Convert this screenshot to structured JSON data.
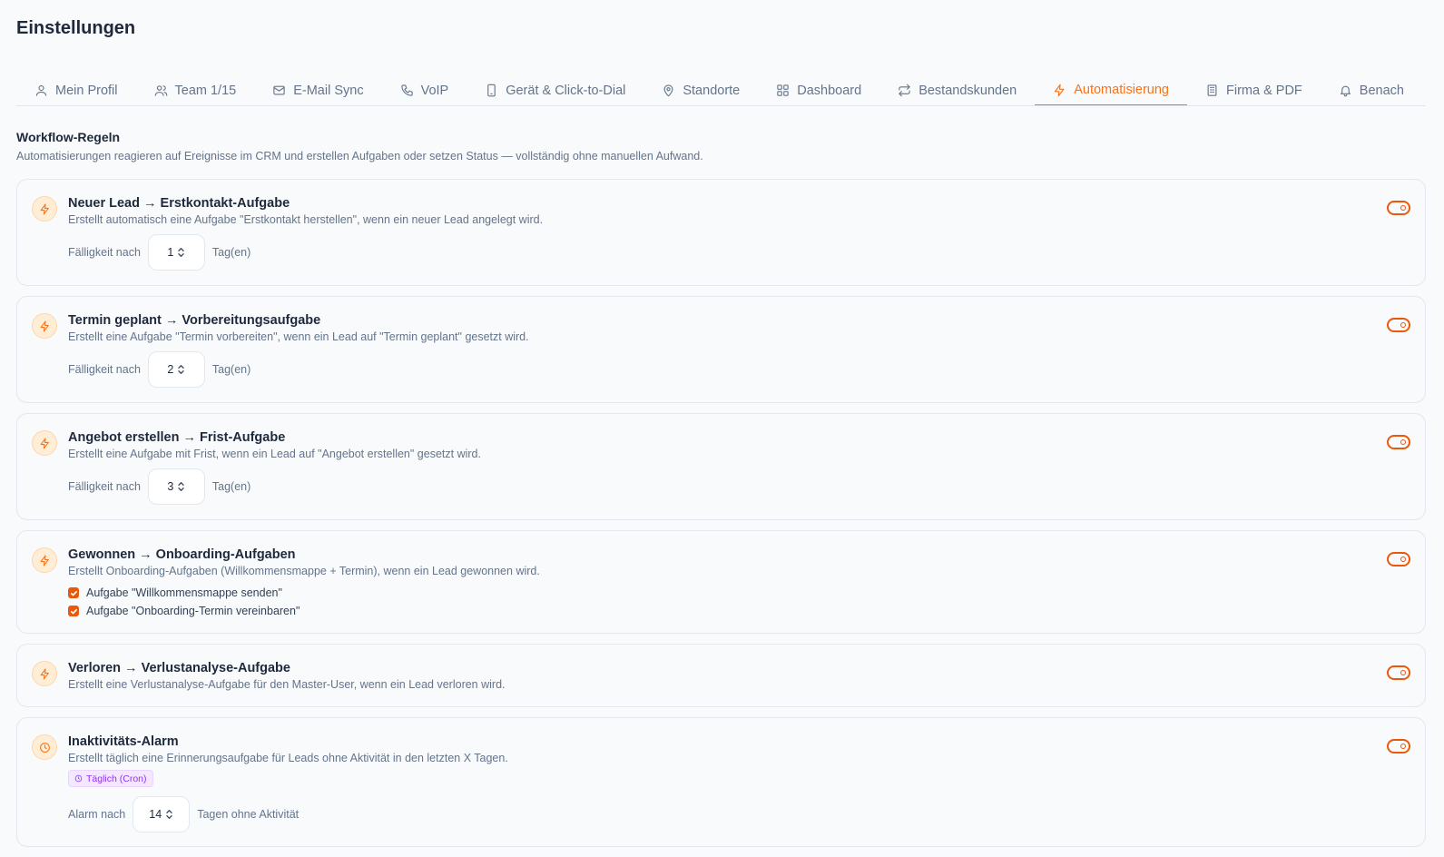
{
  "page": {
    "title": "Einstellungen"
  },
  "tabs": [
    {
      "label": "Mein Profil",
      "icon": "user-icon"
    },
    {
      "label": "Team 1/15",
      "icon": "users-icon"
    },
    {
      "label": "E-Mail Sync",
      "icon": "mail-icon"
    },
    {
      "label": "VoIP",
      "icon": "phone-icon"
    },
    {
      "label": "Gerät & Click-to-Dial",
      "icon": "smartphone-icon"
    },
    {
      "label": "Standorte",
      "icon": "map-pin-icon"
    },
    {
      "label": "Dashboard",
      "icon": "dashboard-grid-icon"
    },
    {
      "label": "Bestandskunden",
      "icon": "repeat-icon"
    },
    {
      "label": "Automatisierung",
      "icon": "zap-icon",
      "active": true
    },
    {
      "label": "Firma & PDF",
      "icon": "building-icon"
    },
    {
      "label": "Benach",
      "icon": "bell-icon"
    }
  ],
  "section": {
    "title": "Workflow-Regeln",
    "subtitle": "Automatisierungen reagieren auf Ereignisse im CRM und erstellen Aufgaben oder setzen Status — vollständig ohne manuellen Aufwand."
  },
  "rules": [
    {
      "title": "Neuer Lead → Erstkontakt-Aufgabe",
      "description": "Erstellt automatisch eine Aufgabe \"Erstkontakt herstellen\", wenn ein neuer Lead angelegt wird.",
      "enabled": true,
      "icon": "zap-icon",
      "field": {
        "label": "Fälligkeit nach",
        "value": "1",
        "unit": "Tag(en)"
      }
    },
    {
      "title": "Termin geplant → Vorbereitungsaufgabe",
      "description": "Erstellt eine Aufgabe \"Termin vorbereiten\", wenn ein Lead auf \"Termin geplant\" gesetzt wird.",
      "enabled": true,
      "icon": "zap-icon",
      "field": {
        "label": "Fälligkeit nach",
        "value": "2",
        "unit": "Tag(en)"
      }
    },
    {
      "title": "Angebot erstellen → Frist-Aufgabe",
      "description": "Erstellt eine Aufgabe mit Frist, wenn ein Lead auf \"Angebot erstellen\" gesetzt wird.",
      "enabled": true,
      "icon": "zap-icon",
      "field": {
        "label": "Fälligkeit nach",
        "value": "3",
        "unit": "Tag(en)"
      }
    },
    {
      "title": "Gewonnen → Onboarding-Aufgaben",
      "description": "Erstellt Onboarding-Aufgaben (Willkommensmappe + Termin), wenn ein Lead gewonnen wird.",
      "enabled": true,
      "icon": "zap-icon",
      "checks": [
        {
          "label": "Aufgabe \"Willkommensmappe senden\"",
          "checked": true
        },
        {
          "label": "Aufgabe \"Onboarding-Termin vereinbaren\"",
          "checked": true
        }
      ]
    },
    {
      "title": "Verloren → Verlustanalyse-Aufgabe",
      "description": "Erstellt eine Verlustanalyse-Aufgabe für den Master-User, wenn ein Lead verloren wird.",
      "enabled": true,
      "icon": "zap-icon"
    },
    {
      "title": "Inaktivitäts-Alarm",
      "description": "Erstellt täglich eine Erinnerungsaufgabe für Leads ohne Aktivität in den letzten X Tagen.",
      "enabled": true,
      "icon": "clock-icon",
      "badge": "Täglich (Cron)",
      "field": {
        "label": "Alarm nach",
        "value": "14",
        "unit": "Tagen ohne Aktivität"
      }
    }
  ],
  "colors": {
    "accent": "#f97316",
    "toggle": "#ea580c",
    "badge": "#9333ea"
  }
}
